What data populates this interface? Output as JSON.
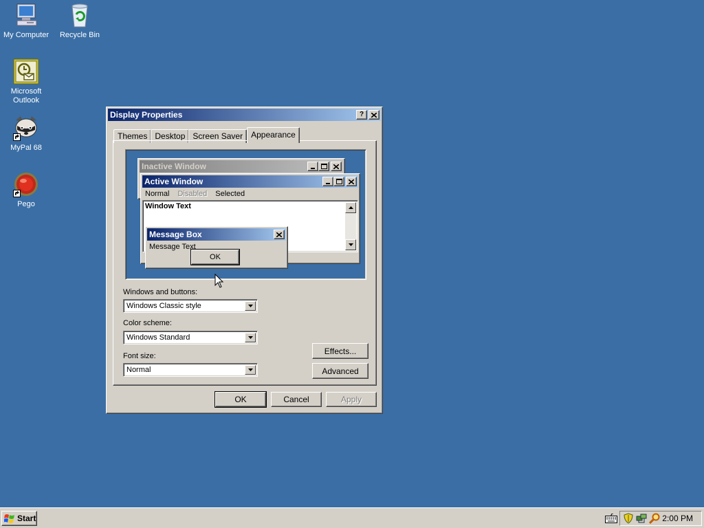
{
  "desktop": {
    "icons": [
      {
        "label": "My Computer",
        "icon": "my-computer-icon"
      },
      {
        "label": "Recycle Bin",
        "icon": "recycle-bin-icon"
      },
      {
        "label": "Microsoft\nOutlook",
        "icon": "outlook-icon"
      },
      {
        "label": "MyPal 68",
        "icon": "mypal-icon"
      },
      {
        "label": "Pego",
        "icon": "pego-icon"
      }
    ]
  },
  "dialog": {
    "title": "Display Properties",
    "help_button": "?",
    "close_button": "×",
    "tabs": [
      {
        "label": "Themes",
        "selected": false
      },
      {
        "label": "Desktop",
        "selected": false
      },
      {
        "label": "Screen Saver",
        "selected": false
      },
      {
        "label": "Appearance",
        "selected": true
      }
    ],
    "preview": {
      "inactive_title": "Inactive Window",
      "active_title": "Active Window",
      "menu": {
        "normal": "Normal",
        "disabled": "Disabled",
        "selected": "Selected"
      },
      "window_text": "Window Text",
      "message_box_title": "Message Box",
      "message_text": "Message Text",
      "ok": "OK"
    },
    "windows_buttons_label": "Windows and buttons:",
    "windows_buttons_value": "Windows Classic style",
    "color_scheme_label": "Color scheme:",
    "color_scheme_value": "Windows Standard",
    "font_size_label": "Font size:",
    "font_size_value": "Normal",
    "effects_button": "Effects...",
    "advanced_button": "Advanced",
    "ok_button": "OK",
    "cancel_button": "Cancel",
    "apply_button": "Apply"
  },
  "taskbar": {
    "start_label": "Start",
    "clock": "2:00 PM"
  },
  "colors": {
    "desktop": "#3a6ea5",
    "face": "#d4d0c8",
    "active_title_start": "#0a246a",
    "active_title_end": "#a6caf0"
  }
}
